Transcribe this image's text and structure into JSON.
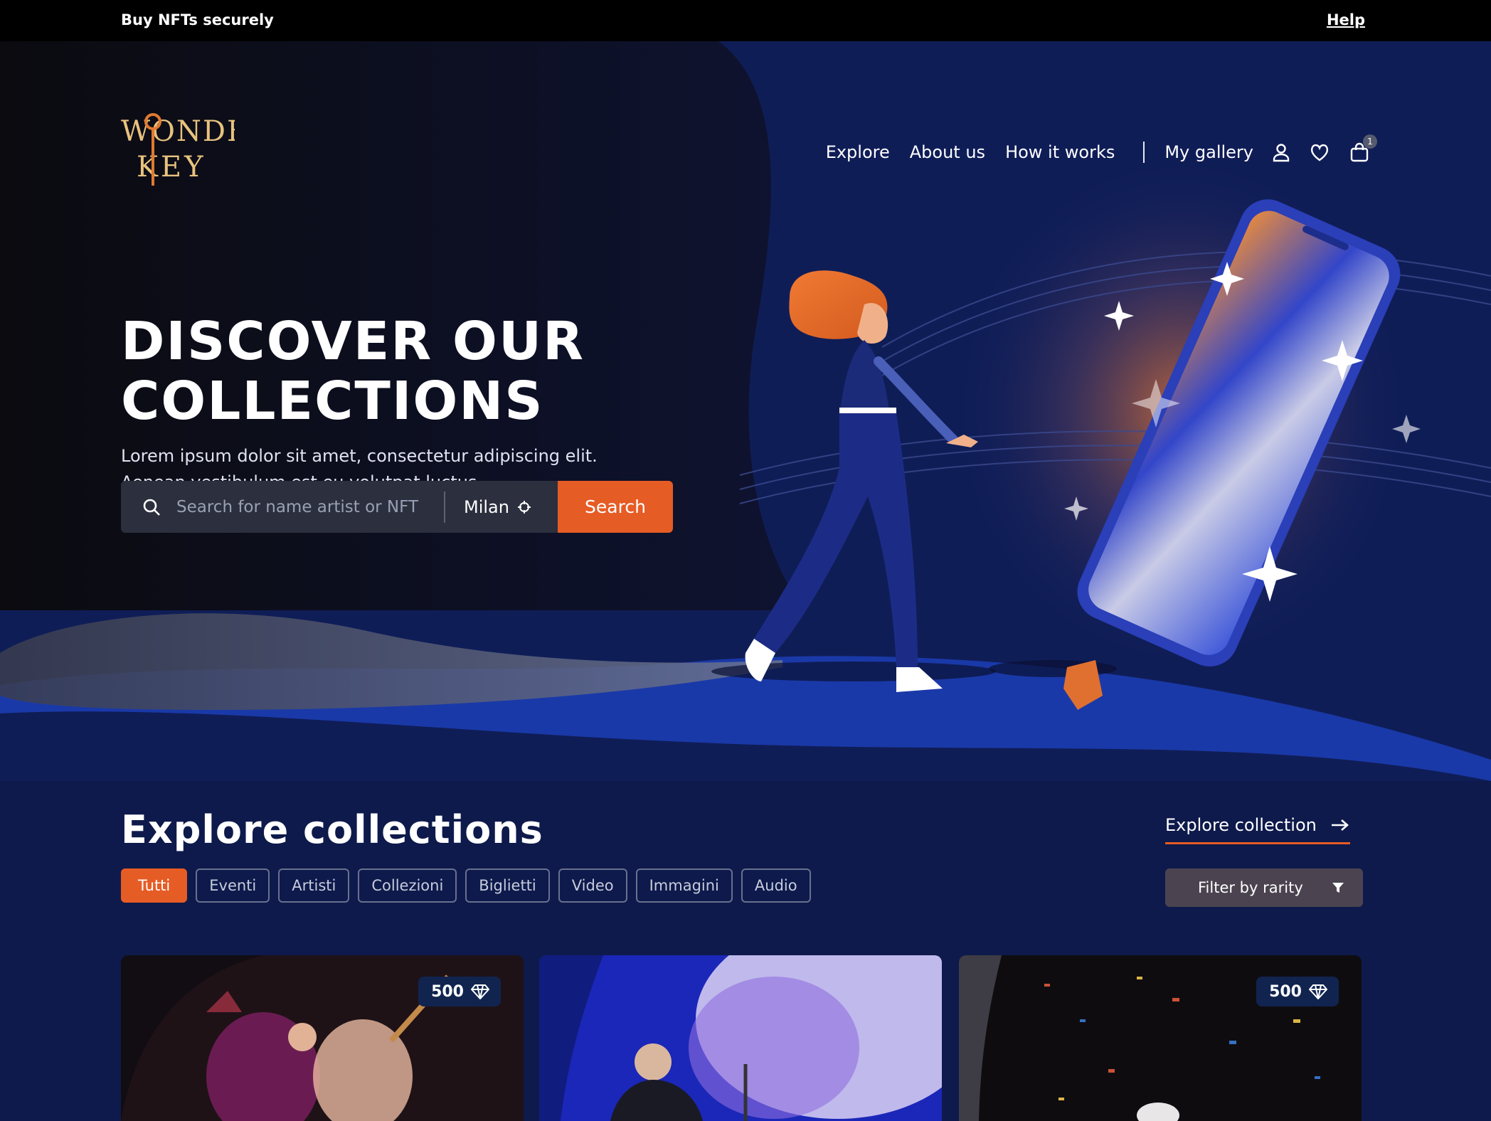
{
  "topbar": {
    "tagline": "Buy NFTs securely",
    "help": "Help"
  },
  "brand": {
    "logo_line1": "WONDER",
    "logo_line2": "KEY"
  },
  "nav": {
    "items": [
      "Explore",
      "About us",
      "How it works",
      "My gallery"
    ],
    "cart_count": "1",
    "icons": [
      "user-icon",
      "heart-icon",
      "shopping-bag-icon"
    ]
  },
  "hero": {
    "headline_line1": "DISCOVER OUR",
    "headline_line2": "COLLECTIONS",
    "sub_line1": "Lorem ipsum dolor sit amet, consectetur adipiscing elit.",
    "sub_line2": "Aenean vestibulum est eu volutpat luctus."
  },
  "search": {
    "placeholder": "Search for name artist or NFT",
    "location": "Milan",
    "button": "Search"
  },
  "explore": {
    "title": "Explore collections",
    "link": "Explore collection",
    "filter": "Filter by rarity",
    "chips": [
      "Tutti",
      "Eventi",
      "Artisti",
      "Collezioni",
      "Biglietti",
      "Video",
      "Immagini",
      "Audio"
    ],
    "active_chip": "Tutti"
  },
  "cards": [
    {
      "price": "500"
    },
    {
      "price": ""
    },
    {
      "price": "500"
    }
  ],
  "colors": {
    "accent": "#e65c25",
    "navy": "#0e1a4b",
    "dark": "#0c0c12"
  }
}
